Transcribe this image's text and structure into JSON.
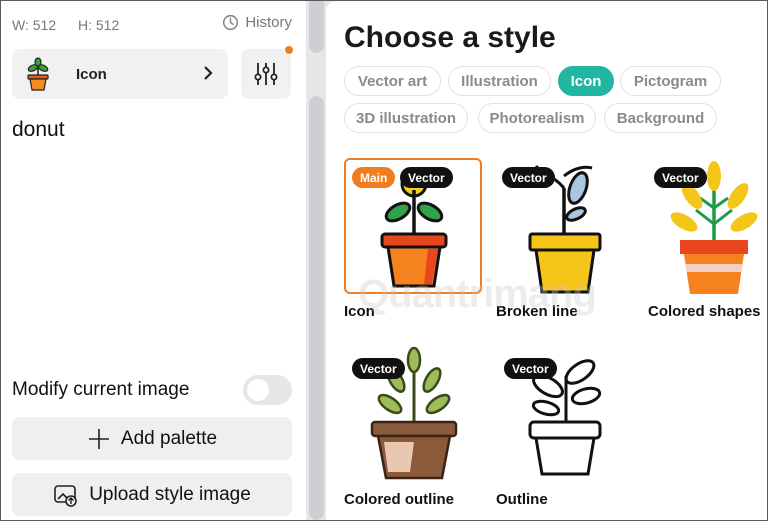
{
  "left_panel": {
    "width_label": "W: 512",
    "height_label": "H: 512",
    "history_label": "History",
    "style_select": {
      "label": "Icon"
    },
    "prompt_text": "donut",
    "modify_label": "Modify current image",
    "modify_enabled": false,
    "add_palette_label": "Add palette",
    "upload_style_label": "Upload style image"
  },
  "right_panel": {
    "heading": "Choose a style",
    "categories": [
      {
        "label": "Vector art",
        "active": false
      },
      {
        "label": "Illustration",
        "active": false
      },
      {
        "label": "Icon",
        "active": true
      },
      {
        "label": "Pictogram",
        "active": false
      },
      {
        "label": "3D illustration",
        "active": false
      },
      {
        "label": "Photorealism",
        "active": false
      },
      {
        "label": "Background",
        "active": false
      }
    ],
    "styles": [
      {
        "name": "Icon",
        "badges": [
          "Main",
          "Vector"
        ],
        "selected": true
      },
      {
        "name": "Broken line",
        "badges": [
          "Vector"
        ],
        "selected": false
      },
      {
        "name": "Colored shapes",
        "badges": [
          "Vector"
        ],
        "selected": false
      },
      {
        "name": "Colored outline",
        "badges": [
          "Vector"
        ],
        "selected": false
      },
      {
        "name": "Outline",
        "badges": [
          "Vector"
        ],
        "selected": false
      }
    ]
  },
  "watermark": "Quantrimang",
  "colors": {
    "accent_teal": "#22b5a1",
    "accent_orange": "#f07d1f"
  },
  "icons": [
    "clock-icon",
    "chevron-right-icon",
    "sliders-icon",
    "plus-icon",
    "image-upload-icon",
    "plant-pot-icon"
  ]
}
